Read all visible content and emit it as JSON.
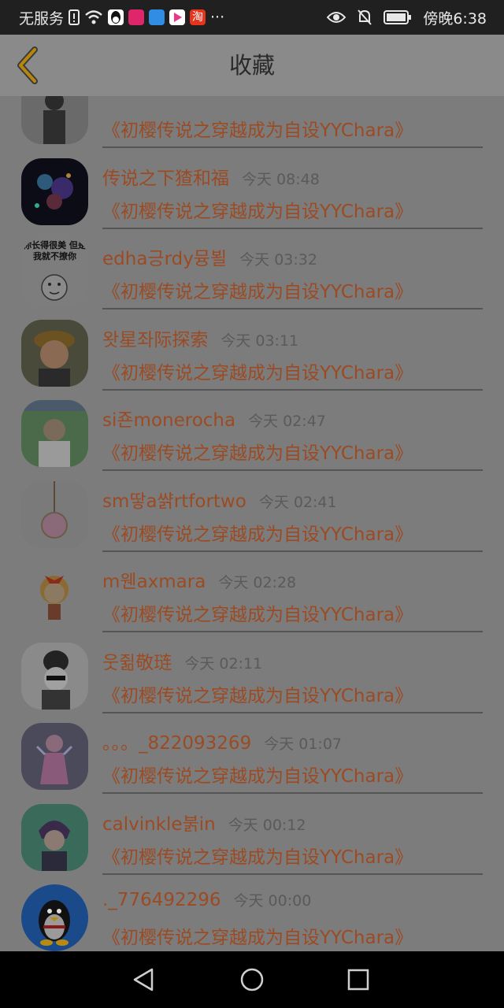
{
  "status_bar": {
    "carrier": "无服务",
    "time": "傍晚6:38",
    "taobao_label": "淘",
    "more": "···"
  },
  "header": {
    "title": "收藏"
  },
  "subtitle_text": "《初樱传说之穿越成为自设YYChara》",
  "items": [
    {
      "name": "",
      "time": ""
    },
    {
      "name": "传说之下猹和福",
      "time": "今天 08:48"
    },
    {
      "name": "edha긍rdy뮹뵐",
      "time": "今天 03:32"
    },
    {
      "name": "왓星좌际探索",
      "time": "今天 03:11"
    },
    {
      "name": "si죤monerocha",
      "time": "今天 02:47"
    },
    {
      "name": "sm땋a쌹rtfortwo",
      "time": "今天 02:41"
    },
    {
      "name": "m웬axmara",
      "time": "今天 02:28"
    },
    {
      "name": "웃쥚敬琏",
      "time": "今天 02:11"
    },
    {
      "name": "。。。_822093269",
      "time": "今天 01:07"
    },
    {
      "name": "calvinkle붉in",
      "time": "今天 00:12"
    },
    {
      "name": "._776492296",
      "time": "今天 00:00"
    }
  ],
  "avatars": [
    {
      "caption": ""
    },
    {
      "caption": ""
    },
    {
      "caption": "你长得很美 但是我就不撩你"
    },
    {
      "caption": ""
    },
    {
      "caption": ""
    },
    {
      "caption": ""
    },
    {
      "caption": ""
    },
    {
      "caption": ""
    },
    {
      "caption": ""
    },
    {
      "caption": ""
    },
    {
      "caption": ""
    }
  ],
  "colors": {
    "accent_text": "#9b4b23",
    "overlay": "#7c7c7c",
    "back_arrow": "#b8860b"
  },
  "icons": {
    "back": "chevron-left-icon",
    "nav_back": "triangle-back-icon",
    "nav_home": "circle-home-icon",
    "nav_recent": "square-recent-icon"
  }
}
